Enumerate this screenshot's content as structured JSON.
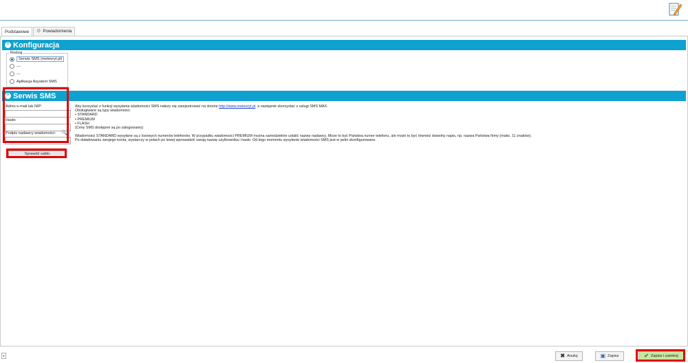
{
  "tabs": [
    {
      "label": "Podstawowe"
    },
    {
      "label": "Powiadomienia"
    }
  ],
  "sections": {
    "konfiguracja": {
      "title": "Konfiguracja"
    },
    "serwis_sms": {
      "title": "Serwis SMS"
    }
  },
  "rodzaj": {
    "legend": "Rodzaj",
    "options": [
      {
        "label": "Serwis SMS (meteoryt.pl)",
        "checked": true
      },
      {
        "label": "---",
        "checked": false
      },
      {
        "label": "---",
        "checked": false
      },
      {
        "label": "Aplikacja Asystent SMS",
        "checked": false
      }
    ]
  },
  "form": {
    "email_label": "Adres e-mail lub NIP:",
    "email_value": "",
    "password_label": "Hasło:",
    "password_value": "",
    "sender_label": "Podpis nadawcy wiadomości:",
    "sender_value": "",
    "check_balance": "Sprawdź saldo"
  },
  "info": {
    "line1_a": "Aby korzystać z funkcji wysyłania wiadomości SMS należy się zarejestrować na stronie ",
    "link": "http://www.meteoryt.pl",
    "line1_b": ", a następnie skorzystać z usługi SMS MAX.",
    "types_label": "Obsługiwane są typy wiadomości:",
    "types": [
      "STANDARD",
      "PREMIUM",
      "FLASH"
    ],
    "prices_note": "(Ceny SMS dostępne są po zalogowaniu)",
    "para2": "Wiadomości STANDARD wysyłane są z losowych numerów telefonów. W przypadku wiadomości PREMIUM można samodzielnie ustalić nazwę nadawcy. Może to być Państwa numer telefonu, ale może to być również dowolny napis, np. nazwa Państwa firmy (maks. 11 znaków).",
    "para3": "Po doładowaniu swojego konta, wystarczy w polach po lewej wprowadzić swoją nazwę użytkownika i hasło. Od tego momentu wysyłanie wiadomości SMS jest w pełni skonfigurowane."
  },
  "footer": {
    "cancel": "Anuluj",
    "save": "Zapisz",
    "save_close": "Zapisz i zamknij"
  },
  "colors": {
    "section_header": "#0fa1cf",
    "highlight": "#e00000",
    "save_close_bg": "#c8e6a0"
  }
}
